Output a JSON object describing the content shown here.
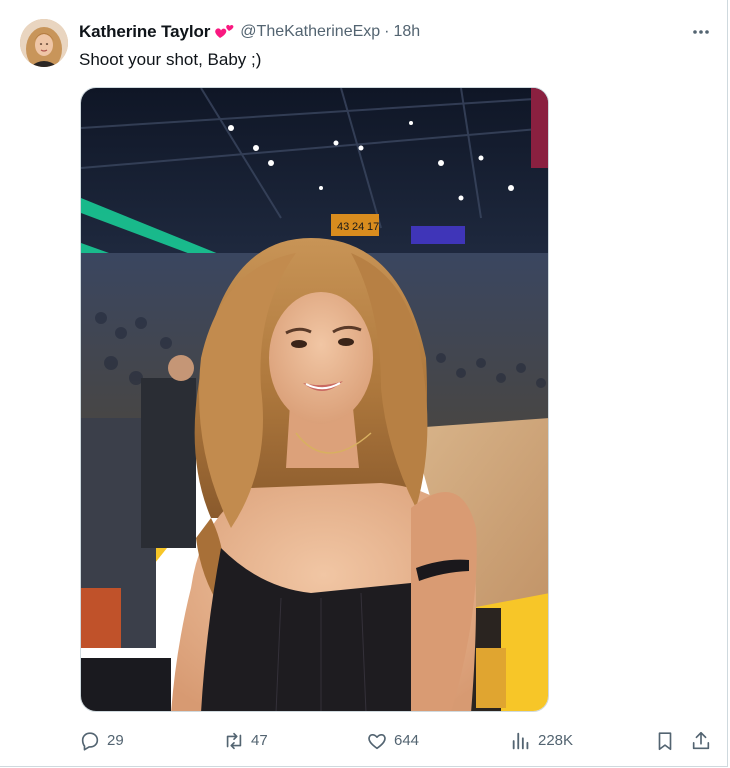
{
  "tweet": {
    "author_name": "Katherine Taylor",
    "author_badge_icon": "two-hearts-icon",
    "handle": "@TheKatherineExp",
    "separator": "·",
    "time": "18h",
    "text": "Shoot your shot, Baby ;)",
    "more_icon": "more-horizontal-icon"
  },
  "media": {
    "scoreboard_digits": [
      "43",
      "24",
      "17"
    ]
  },
  "actions": {
    "replies": "29",
    "retweets": "47",
    "likes": "644",
    "views": "228K",
    "bookmark_icon": "bookmark-icon",
    "share_icon": "share-icon"
  },
  "colors": {
    "text_primary": "#0f1419",
    "text_secondary": "#536471",
    "hearts": "#f91880",
    "border": "#cfd9de"
  }
}
